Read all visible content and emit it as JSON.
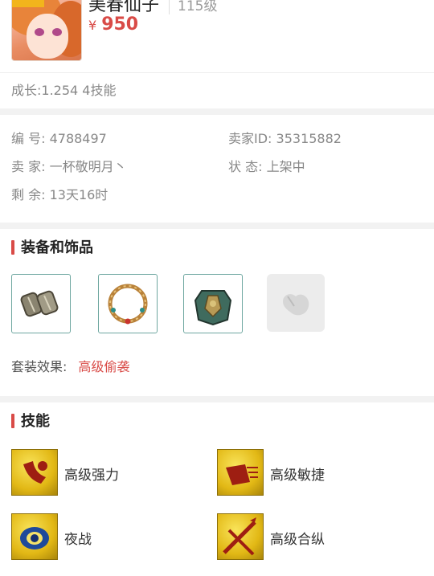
{
  "pet": {
    "name": "美春仙子",
    "level": "115级",
    "price_symbol": "¥",
    "price": "950",
    "growth_text": "成长:1.254 4技能"
  },
  "info": {
    "id_label": "编 号:",
    "id_value": "4788497",
    "seller_id_label": "卖家ID:",
    "seller_id_value": "35315882",
    "seller_label": "卖 家:",
    "seller_value": "一杯敬明月丶",
    "status_label": "状 态:",
    "status_value": "上架中",
    "remain_label": "剩 余:",
    "remain_value": "13天16时"
  },
  "equipment": {
    "title": "装备和饰品",
    "items": [
      {
        "icon": "bracer-icon"
      },
      {
        "icon": "necklace-icon"
      },
      {
        "icon": "armor-icon"
      },
      {
        "icon": "empty-slot-icon"
      }
    ],
    "set_label": "套装效果:",
    "set_value": "高级偷袭"
  },
  "skills": {
    "title": "技能",
    "items": [
      {
        "label": "高级强力",
        "icon": "strength-skill-icon"
      },
      {
        "label": "高级敏捷",
        "icon": "agility-skill-icon"
      },
      {
        "label": "夜战",
        "icon": "night-combat-skill-icon"
      },
      {
        "label": "高级合纵",
        "icon": "alliance-skill-icon"
      }
    ]
  },
  "colors": {
    "accent": "#d94b47",
    "skill_gold": "#e2b815"
  }
}
